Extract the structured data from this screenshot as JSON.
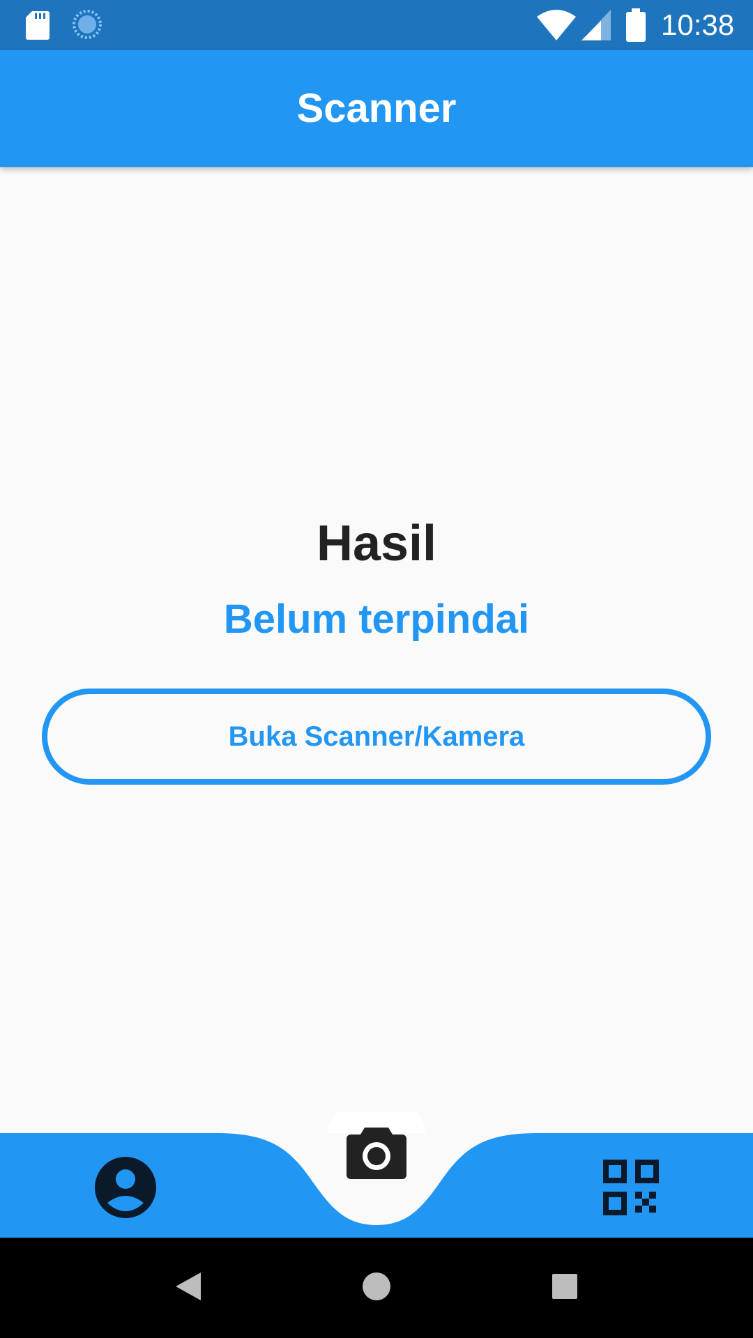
{
  "status_bar": {
    "time": "10:38",
    "icons": [
      "sd-card-icon",
      "sync-icon",
      "wifi-icon",
      "cell-signal-icon",
      "battery-icon"
    ]
  },
  "app_bar": {
    "title": "Scanner"
  },
  "main": {
    "result_heading": "Hasil",
    "result_value": "Belum terpindai",
    "scan_button_label": "Buka Scanner/Kamera"
  },
  "bottom_nav": {
    "items": [
      {
        "icon": "account-circle-icon"
      },
      {
        "icon": "camera-icon",
        "active": true
      },
      {
        "icon": "qr-code-icon"
      }
    ]
  },
  "system_nav": {
    "items": [
      {
        "icon": "back-triangle-icon"
      },
      {
        "icon": "home-circle-icon"
      },
      {
        "icon": "recent-apps-square-icon"
      }
    ]
  },
  "colors": {
    "primary": "#2196f3",
    "status_bar": "#1e74bd",
    "background": "#fafafa",
    "heading_text": "#222222",
    "nav_icon": "#0b1a2b"
  }
}
